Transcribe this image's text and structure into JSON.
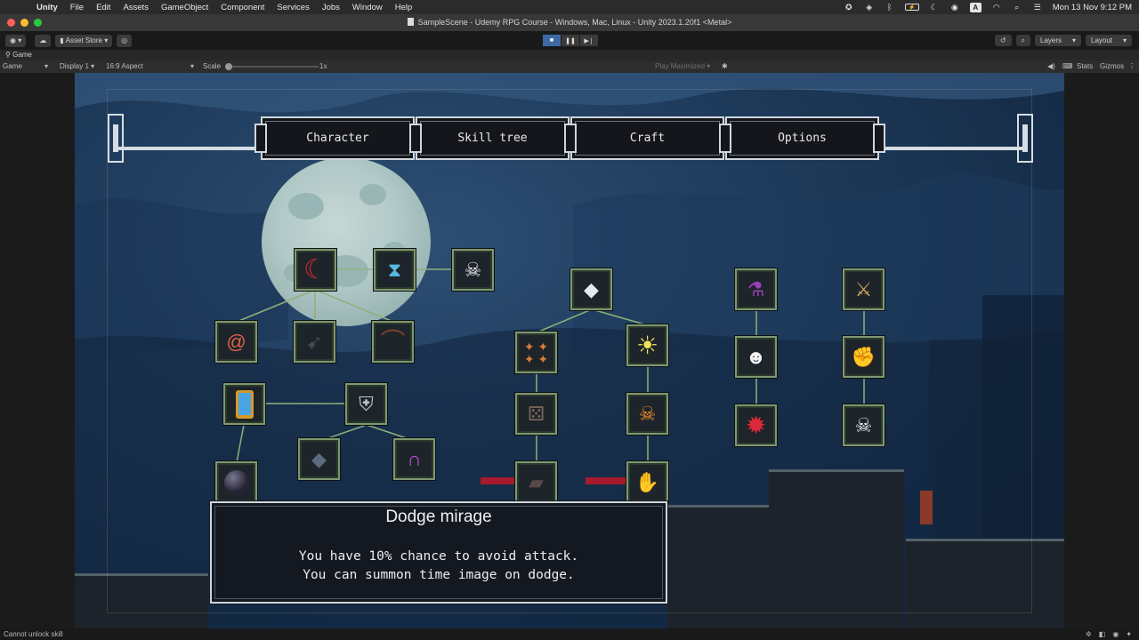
{
  "menubar": {
    "apple_icon": "apple-logo",
    "items": [
      "Unity",
      "File",
      "Edit",
      "Assets",
      "GameObject",
      "Component",
      "Services",
      "Jobs",
      "Window",
      "Help"
    ],
    "status_icons": [
      "unity-hub-icon",
      "dropbox-icon",
      "bluetooth-icon",
      "battery-icon",
      "focus-moon-icon",
      "play-circle-icon"
    ],
    "input_source": "A",
    "clock": "Mon 13 Nov  9:12 PM"
  },
  "window": {
    "title": "SampleScene - Udemy RPG Course - Windows, Mac, Linux - Unity 2023.1.20f1 <Metal>"
  },
  "toolbar": {
    "asset_store_label": "Asset Store",
    "layers_label": "Layers",
    "layout_label": "Layout"
  },
  "game_view": {
    "tab_label": "Game",
    "mode_label": "Game",
    "display_label": "Display 1",
    "aspect_label": "16:9 Aspect",
    "scale_label": "Scale",
    "scale_value": "1x",
    "play_maximized_label": "Play Maximized",
    "stats_label": "Stats",
    "gizmos_label": "Gizmos"
  },
  "game_ui": {
    "tabs": [
      "Character",
      "Skill tree",
      "Craft",
      "Options"
    ],
    "skills": [
      {
        "id": "dash-red",
        "icon": "red-scythe-icon",
        "color": "#c8282e"
      },
      {
        "id": "hourglass",
        "icon": "hourglass-icon",
        "color": "#58b7e0"
      },
      {
        "id": "skull-sword",
        "icon": "skull-sword-icon",
        "color": "#e8e8e8"
      },
      {
        "id": "spiral",
        "icon": "spiral-rune-icon",
        "color": "#d9604a"
      },
      {
        "id": "dark-blade",
        "icon": "dark-blade-icon",
        "color": "#3a3a3a"
      },
      {
        "id": "boomerang",
        "icon": "boomerang-icon",
        "color": "#6b3a2a"
      },
      {
        "id": "mirror",
        "icon": "mirror-icon",
        "color": "#4aa0e0"
      },
      {
        "id": "knight",
        "icon": "knight-shield-icon",
        "color": "#b6bcc4"
      },
      {
        "id": "orb",
        "icon": "dark-orb-icon",
        "color": "#2a2838"
      },
      {
        "id": "rubble",
        "icon": "rubble-icon",
        "color": "#5a6578"
      },
      {
        "id": "shadow-portal",
        "icon": "shadow-portal-icon",
        "color": "#b24ad6"
      },
      {
        "id": "diamond",
        "icon": "diamond-icon",
        "color": "#dfe6ec"
      },
      {
        "id": "sparks",
        "icon": "sparks-icon",
        "color": "#d77a3a"
      },
      {
        "id": "sun",
        "icon": "sun-burst-icon",
        "color": "#f1e05a"
      },
      {
        "id": "dice",
        "icon": "dice-icon",
        "color": "#6a5a50"
      },
      {
        "id": "fire-skull",
        "icon": "fire-skull-icon",
        "color": "#f08a2a"
      },
      {
        "id": "card",
        "icon": "card-icon",
        "color": "#4a3a3a"
      },
      {
        "id": "magic-hand",
        "icon": "magic-hand-icon",
        "color": "#f0c090"
      },
      {
        "id": "purple-mage",
        "icon": "purple-hat-icon",
        "color": "#8a3aa8"
      },
      {
        "id": "grin",
        "icon": "evil-grin-icon",
        "color": "#f2f2f2"
      },
      {
        "id": "red-burst",
        "icon": "red-burst-icon",
        "color": "#d8283a"
      },
      {
        "id": "crossbow",
        "icon": "crossbow-sword-icon",
        "color": "#d0a060"
      },
      {
        "id": "fist",
        "icon": "fist-icon",
        "color": "#e8b090"
      },
      {
        "id": "ghost-skull",
        "icon": "ghost-skull-icon",
        "color": "#eaeaea"
      }
    ],
    "tooltip": {
      "title": "Dodge mirage",
      "line1": "You have 10% chance to avoid attack.",
      "line2": "You can summon time image on dodge."
    }
  },
  "statusbar": {
    "message": "Cannot unlock skill"
  }
}
